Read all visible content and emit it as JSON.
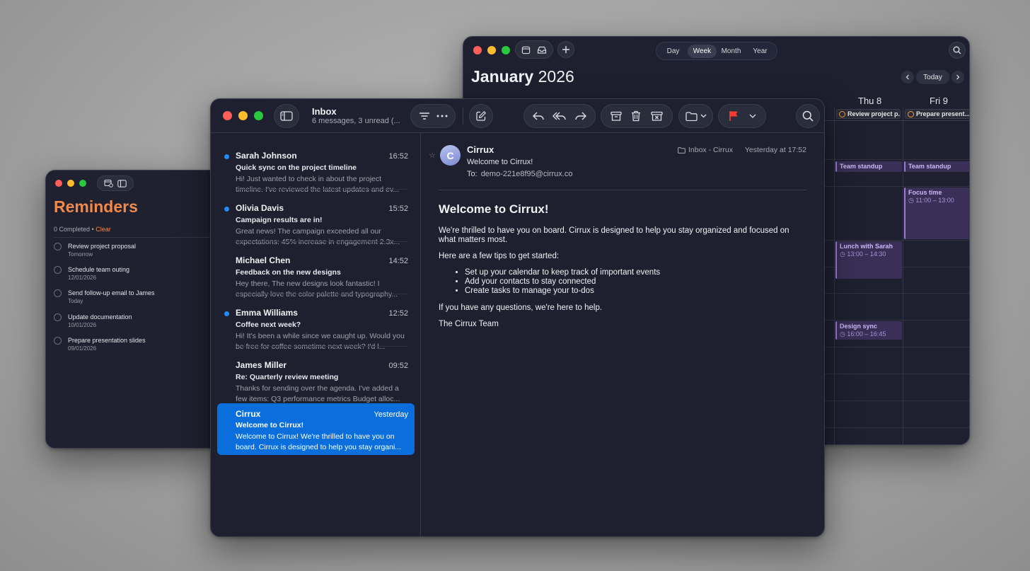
{
  "calendar": {
    "title_month": "January",
    "title_year": "2026",
    "views": [
      "Day",
      "Week",
      "Month",
      "Year"
    ],
    "active_view": "Week",
    "today_label": "Today",
    "days": [
      "Thu 8",
      "Fri 9"
    ],
    "allday": [
      "Review project p...",
      "Prepare present..."
    ],
    "events": [
      {
        "title": "Team standup",
        "time": ""
      },
      {
        "title": "Team standup",
        "time": ""
      },
      {
        "title": "Focus time",
        "time": "11:00 – 13:00"
      },
      {
        "title": "Lunch with Sarah",
        "time": "13:00 – 14:30"
      },
      {
        "title": "Design sync",
        "time": "16:00 – 16:45"
      }
    ]
  },
  "reminders": {
    "title": "Reminders",
    "completed": "0 Completed",
    "separator": "•",
    "clear": "Clear",
    "items": [
      {
        "title": "Review project proposal",
        "date": "Tomorrow"
      },
      {
        "title": "Schedule team outing",
        "date": "12/01/2026"
      },
      {
        "title": "Send follow-up email to James",
        "date": "Today"
      },
      {
        "title": "Update documentation",
        "date": "10/01/2026"
      },
      {
        "title": "Prepare presentation slides",
        "date": "09/01/2026"
      }
    ]
  },
  "mail": {
    "mailbox": "Inbox",
    "mailbox_summary": "6 messages, 3 unread (...",
    "messages": [
      {
        "from": "Sarah Johnson",
        "time": "16:52",
        "subject": "Quick sync on the project timeline",
        "preview": "Hi! Just wanted to check in about the project timeline. I've reviewed the latest updates and ev...",
        "unread": true
      },
      {
        "from": "Olivia Davis",
        "time": "15:52",
        "subject": "Campaign results are in!",
        "preview": "Great news! The campaign exceeded all our expectations: 45% increase in engagement 2.3x...",
        "unread": true
      },
      {
        "from": "Michael Chen",
        "time": "14:52",
        "subject": "Feedback on the new designs",
        "preview": "Hey there, The new designs look fantastic! I especially love the color palette and typography...",
        "unread": false
      },
      {
        "from": "Emma Williams",
        "time": "12:52",
        "subject": "Coffee next week?",
        "preview": "Hi! It's been a while since we caught up. Would you be free for coffee sometime next week? I'd l...",
        "unread": true
      },
      {
        "from": "James Miller",
        "time": "09:52",
        "subject": "Re: Quarterly review meeting",
        "preview": "Thanks for sending over the agenda. I've added a few items: Q3 performance metrics Budget alloc...",
        "unread": false
      },
      {
        "from": "Cirrux",
        "time": "Yesterday",
        "subject": "Welcome to Cirrux!",
        "preview": "Welcome to Cirrux! We're thrilled to have you on board. Cirrux is designed to help you stay organi...",
        "unread": false
      }
    ],
    "reader": {
      "avatar_letter": "C",
      "star": "☆",
      "from": "Cirrux",
      "subject": "Welcome to Cirrux!",
      "to_label": "To:",
      "to_address": "demo-221e8f95@cirrux.co",
      "folder": "Inbox - Cirrux",
      "date": "Yesterday at 17:52",
      "heading": "Welcome to Cirrux!",
      "para1": "We're thrilled to have you on board. Cirrux is designed to help you stay organized and focused on what matters most.",
      "para2": "Here are a few tips to get started:",
      "tips": [
        "Set up your calendar to keep track of important events",
        "Add your contacts to stay connected",
        "Create tasks to manage your to-dos"
      ],
      "para3": "If you have any questions, we're here to help.",
      "signoff": "The Cirrux Team"
    }
  },
  "colors": {
    "accent_blue": "#0a6fdd",
    "unread_dot": "#1f8cff",
    "reminders_orange": "#f0894a",
    "flag_red": "#ff3b30",
    "event_purple": "#9b7ad8"
  }
}
